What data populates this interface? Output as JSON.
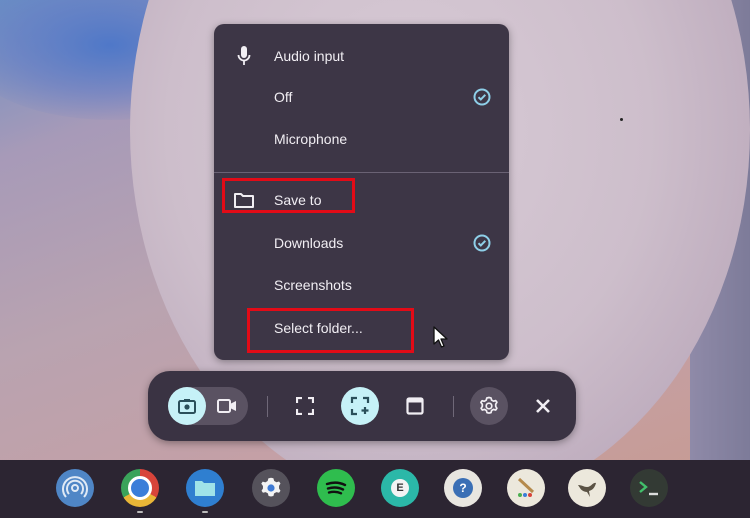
{
  "capture_settings_menu": {
    "audio_input": {
      "header": "Audio input",
      "icon": "microphone-icon",
      "options": [
        {
          "label": "Off",
          "selected": true
        },
        {
          "label": "Microphone",
          "selected": false
        }
      ]
    },
    "save_to": {
      "header": "Save to",
      "icon": "folder-icon",
      "options": [
        {
          "label": "Downloads",
          "selected": true
        },
        {
          "label": "Screenshots",
          "selected": false
        },
        {
          "label": "Select folder...",
          "selected": false
        }
      ]
    },
    "annotation_color": "#e30b17",
    "check_color": "#8ecfe8"
  },
  "capture_toolbar": {
    "mode_toggle": [
      {
        "name": "screenshot",
        "icon": "camera-icon",
        "active": true
      },
      {
        "name": "screen-record",
        "icon": "video-camera-icon",
        "active": false
      }
    ],
    "capture_types": [
      {
        "name": "full-screen",
        "icon": "fullscreen-icon",
        "active": false
      },
      {
        "name": "partial-screen",
        "icon": "partial-capture-icon",
        "active": true
      },
      {
        "name": "window",
        "icon": "window-icon",
        "active": false
      }
    ],
    "settings_icon": "gear-icon",
    "close_icon": "close-icon",
    "accent_color": "#c6f1f7"
  },
  "shelf": {
    "apps": [
      {
        "name": "nearby-share",
        "icon": "nearby-share-icon",
        "running": false
      },
      {
        "name": "chrome",
        "icon": "chrome-icon",
        "running": true
      },
      {
        "name": "files",
        "icon": "files-icon",
        "running": true
      },
      {
        "name": "settings",
        "icon": "settings-icon",
        "running": false
      },
      {
        "name": "spotify",
        "icon": "spotify-icon",
        "running": false
      },
      {
        "name": "e-app",
        "icon": "e-app-icon",
        "running": false
      },
      {
        "name": "help-app",
        "icon": "help-app-icon",
        "running": false
      },
      {
        "name": "paint-app",
        "icon": "paint-app-icon",
        "running": false
      },
      {
        "name": "gimp",
        "icon": "gimp-icon",
        "running": false
      },
      {
        "name": "terminal",
        "icon": "terminal-icon",
        "running": false
      }
    ]
  }
}
